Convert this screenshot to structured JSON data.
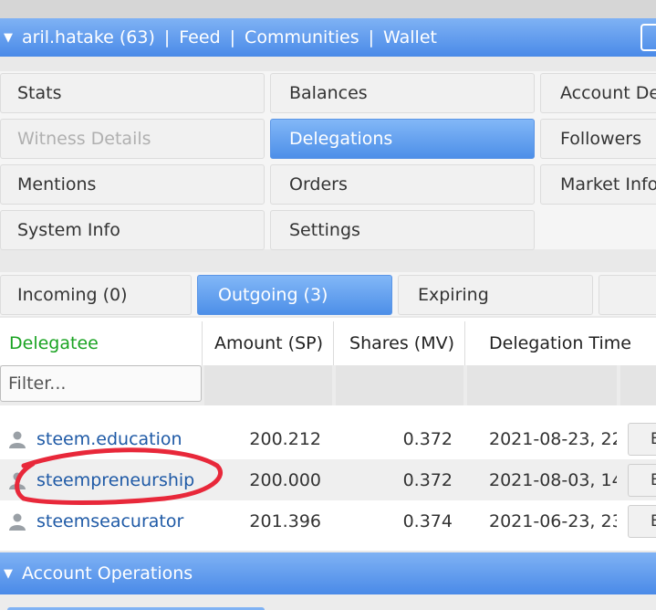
{
  "header": {
    "username": "aril.hatake (63)",
    "separator": "|",
    "links": [
      "Feed",
      "Communities",
      "Wallet"
    ]
  },
  "menu": {
    "items": [
      {
        "label": "Stats",
        "state": "normal"
      },
      {
        "label": "Balances",
        "state": "normal"
      },
      {
        "label": "Account De",
        "state": "normal"
      },
      {
        "label": "Witness Details",
        "state": "disabled"
      },
      {
        "label": "Delegations",
        "state": "active"
      },
      {
        "label": "Followers",
        "state": "normal"
      },
      {
        "label": "Mentions",
        "state": "normal"
      },
      {
        "label": "Orders",
        "state": "normal"
      },
      {
        "label": "Market Info",
        "state": "normal"
      },
      {
        "label": "System Info",
        "state": "normal"
      },
      {
        "label": "Settings",
        "state": "normal"
      }
    ]
  },
  "tabs": [
    {
      "label": "Incoming (0)",
      "active": false
    },
    {
      "label": "Outgoing (3)",
      "active": true
    },
    {
      "label": "Expiring",
      "active": false
    },
    {
      "label": "",
      "active": false
    }
  ],
  "table": {
    "headers": [
      "Delegatee",
      "Amount (SP)",
      "Shares (MV)",
      "Delegation Time"
    ],
    "filter_placeholder": "Filter...",
    "rows": [
      {
        "delegatee": "steem.education",
        "amount": "200.212",
        "shares": "0.372",
        "time": "2021-08-23, 22",
        "action": "E"
      },
      {
        "delegatee": "steempreneurship",
        "amount": "200.000",
        "shares": "0.372",
        "time": "2021-08-03, 14",
        "action": "E"
      },
      {
        "delegatee": "steemseacurator",
        "amount": "201.396",
        "shares": "0.374",
        "time": "2021-06-23, 23",
        "action": "E"
      }
    ]
  },
  "section2": {
    "title": "Account Operations"
  },
  "colors": {
    "accent_blue": "#4a8ae8",
    "link_blue": "#1f5aa6",
    "delegatee_green": "#1aa322",
    "annotation_red": "#e8283a"
  },
  "icons": {
    "collapse": "triangle-down-icon",
    "user": "user-icon"
  }
}
